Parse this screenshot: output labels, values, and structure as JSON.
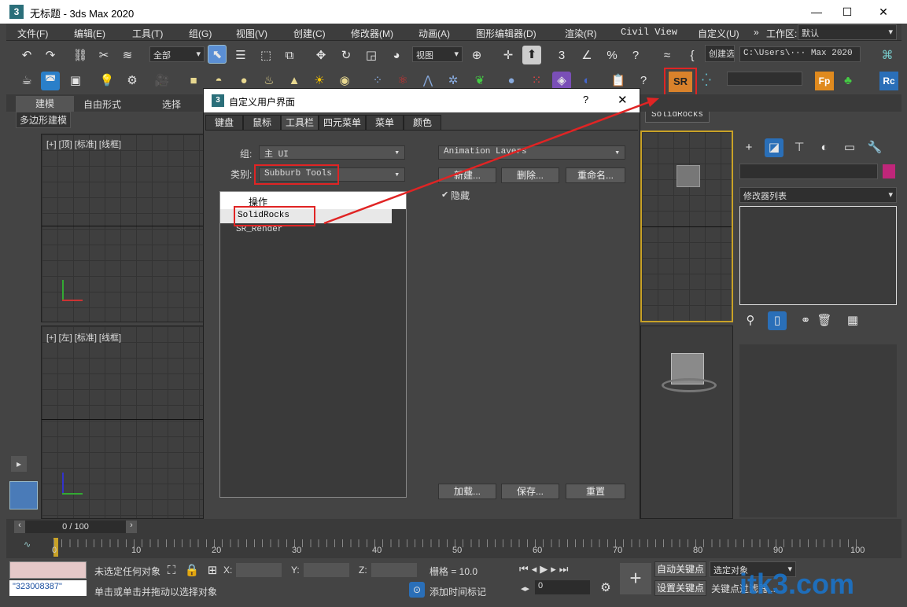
{
  "window": {
    "title": "无标题 - 3ds Max 2020",
    "minimize": "—",
    "maximize": "☐",
    "close": "✕"
  },
  "menu": [
    "文件(F)",
    "编辑(E)",
    "工具(T)",
    "组(G)",
    "视图(V)",
    "创建(C)",
    "修改器(M)",
    "动画(A)",
    "图形编辑器(D)",
    "渲染(R)",
    "Civil View",
    "自定义(U)"
  ],
  "workspace": {
    "overflow": "»",
    "label": "工作区:",
    "value": "默认"
  },
  "toolbar1": {
    "selection_filter": "全部",
    "ref_coord": "视图",
    "create_sel": "创建选",
    "path": "C:\\Users\\··· Max 2020"
  },
  "toolbar2": {
    "sr_label": "SR",
    "fp_label": "Fp",
    "rc_label": "Rc",
    "tooltip": "SolidRocks"
  },
  "ribbon_tabs": {
    "model": "建模",
    "freeform": "自由形式",
    "select": "选择",
    "sub": "多边形建模"
  },
  "viewports": {
    "top_label": "[+] [顶] [标准] [线框]",
    "left_label": "[+] [左] [标准] [线框]"
  },
  "dialog": {
    "title": "自定义用户界面",
    "help": "?",
    "close": "✕",
    "tabs": [
      "键盘",
      "鼠标",
      "工具栏",
      "四元菜单",
      "菜单",
      "颜色"
    ],
    "group_label": "组:",
    "group_value": "主 UI",
    "category_label": "类别:",
    "category_value": "Subburb Tools",
    "action_header": "操作",
    "actions": [
      "SolidRocks",
      "SR_Render"
    ],
    "toolbar_dropdown": "Animation Layers",
    "new_btn": "新建...",
    "delete_btn": "删除...",
    "rename_btn": "重命名...",
    "hide_label": "隐藏",
    "load_btn": "加载...",
    "save_btn": "保存...",
    "reset_btn": "重置"
  },
  "command_panel": {
    "modifier_list": "修改器列表"
  },
  "timeline": {
    "frame_display": "0 / 100",
    "ticks": [
      "0",
      "10",
      "20",
      "30",
      "40",
      "50",
      "60",
      "70",
      "80",
      "90",
      "100"
    ]
  },
  "status": {
    "no_selection": "未选定任何对象",
    "hint": "单击或单击并拖动以选择对象",
    "script_value": "\"323008387\"",
    "x_label": "X:",
    "y_label": "Y:",
    "z_label": "Z:",
    "grid": "栅格 = 10.0",
    "add_time_tag": "添加时间标记",
    "auto_key": "自动关键点",
    "selected_obj": "选定对象",
    "set_key": "设置关键点",
    "key_filter": "关键点过滤器...",
    "frame_field": "0"
  },
  "watermark": "itk3.com"
}
